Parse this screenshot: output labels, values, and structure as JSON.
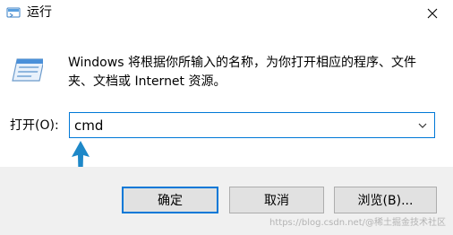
{
  "window": {
    "title": "运行",
    "close_icon": "close-icon"
  },
  "body": {
    "description": "Windows 将根据你所输入的名称，为你打开相应的程序、文件夹、文档或 Internet 资源。",
    "open_label": "打开(O):",
    "command_value": "cmd",
    "dropdown_icon": "chevron-down-icon"
  },
  "buttons": {
    "ok_label": "确定",
    "cancel_label": "取消",
    "browse_label": "浏览(B)..."
  },
  "watermark": {
    "text": "https://blog.csdn.net/@稀土掘金技术社区"
  },
  "colors": {
    "accent": "#0078d7",
    "annotation_arrow": "#1e88c8",
    "footer_bg": "#f0f0f0",
    "button_bg": "#e1e1e1"
  }
}
